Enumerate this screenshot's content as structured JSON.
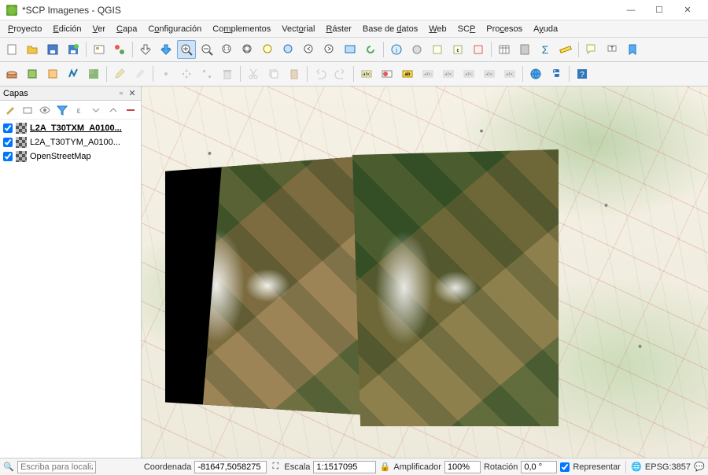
{
  "window": {
    "title": "*SCP Imagenes - QGIS"
  },
  "menu": [
    "Proyecto",
    "Edición",
    "Ver",
    "Capa",
    "Configuración",
    "Complementos",
    "Vectorial",
    "Ráster",
    "Base de datos",
    "Web",
    "SCP",
    "Procesos",
    "Ayuda"
  ],
  "layers_panel": {
    "title": "Capas"
  },
  "layers": [
    {
      "name": "L2A_T30TXM_A0100...",
      "checked": true,
      "active": true,
      "type": "raster"
    },
    {
      "name": "L2A_T30TYM_A0100...",
      "checked": true,
      "active": false,
      "type": "raster"
    },
    {
      "name": "OpenStreetMap",
      "checked": true,
      "active": false,
      "type": "raster"
    }
  ],
  "status": {
    "locator_ph": "Escriba para localizar (Ctrl+K)",
    "coord_label": "Coordenada",
    "coord_value": "-81647,5058275",
    "scale_label": "Escala",
    "scale_value": "1:1517095",
    "amp_label": "Amplificador",
    "amp_value": "100%",
    "rot_label": "Rotación",
    "rot_value": "0,0 °",
    "render_label": "Representar",
    "crs": "EPSG:3857"
  }
}
